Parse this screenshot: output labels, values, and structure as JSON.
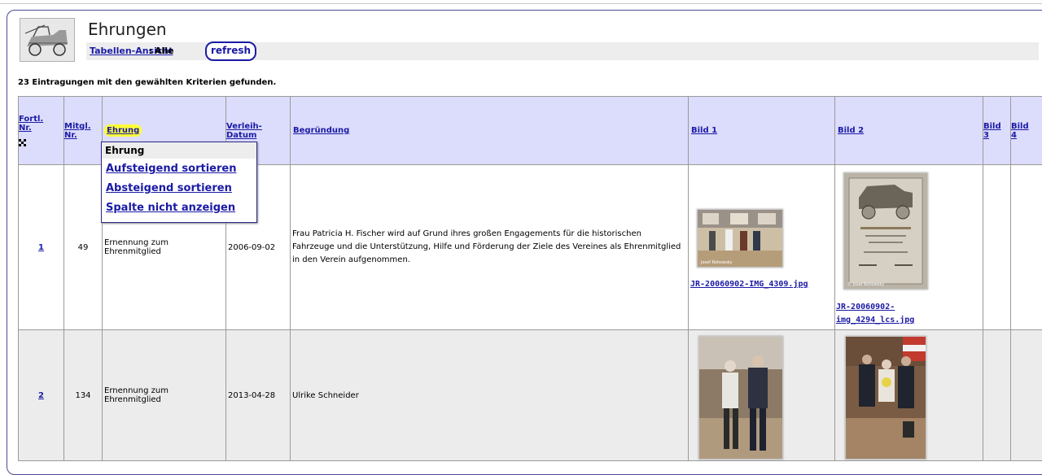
{
  "header": {
    "title": "Ehrungen",
    "view_link": "Tabellen-Ansicht",
    "view_colon": ":",
    "view_value": "Alle",
    "refresh_label": "refresh"
  },
  "result_count": "23 Eintragungen mit den gewählten Kriterien gefunden.",
  "columns": [
    {
      "label": "Fortl. Nr."
    },
    {
      "label": "Mitgl. Nr."
    },
    {
      "label": "Ehrung"
    },
    {
      "label": "Verleih-Datum"
    },
    {
      "label": "Begründung"
    },
    {
      "label": "Bild 1"
    },
    {
      "label": "Bild 2"
    },
    {
      "label": "Bild 3"
    },
    {
      "label": "Bild 4"
    }
  ],
  "column_headers": {
    "fortl_1": "Fortl.",
    "fortl_2": "Nr.",
    "mitgl_1": "Mitgl.",
    "mitgl_2": "Nr.",
    "ehrung": "Ehrung",
    "datum_1": "Verleih-",
    "datum_2": "Datum",
    "begruendung": "Begründung",
    "bild1": "Bild 1",
    "bild2": "Bild 2",
    "bild3_1": "Bild",
    "bild3_2": "3",
    "bild4_1": "Bild",
    "bild4_2": "4"
  },
  "column_menu": {
    "title": "Ehrung",
    "items": [
      "Aufsteigend sortieren",
      "Absteigend sortieren",
      "Spalte nicht anzeigen"
    ]
  },
  "rows": [
    {
      "nr": "1",
      "mitgl": "49",
      "ehrung": "Ernennung zum Ehrenmitglied",
      "datum": "2006-09-02",
      "begruendung": "Frau Patricia H. Fischer wird auf Grund ihres großen Engagements für die historischen Fahrzeuge und die Unterstützung, Hilfe und Förderung der Ziele des Vereines als Ehrenmitglied in den Verein aufgenommen.",
      "bild1": "JR-20060902-IMG_4309.jpg",
      "bild2_line1": "JR-20060902-",
      "bild2_line2": "img_4294_lcs.jpg",
      "bild1_watermark": "Josef Rohowsky",
      "bild2_watermark": "© Josef Rohowsky"
    },
    {
      "nr": "2",
      "mitgl": "134",
      "ehrung": "Ernennung zum Ehrenmitglied",
      "datum": "2013-04-28",
      "begruendung": "Ulrike Schneider"
    }
  ],
  "colors": {
    "header_bg": "#dcdcfc",
    "link": "#1a1aa6",
    "highlight": "#ffff3a",
    "row_alt": "#ececec"
  }
}
